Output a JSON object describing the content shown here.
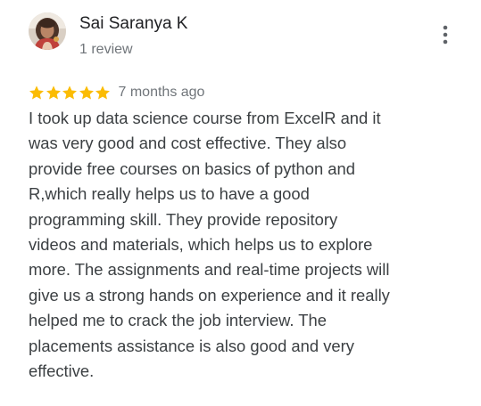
{
  "reviewer": {
    "name": "Sai Saranya K",
    "review_count": "1 review",
    "avatar_icon": "profile-photo"
  },
  "menu": {
    "icon": "more-vert-icon"
  },
  "rating": {
    "stars": 5,
    "max_stars": 5,
    "star_color": "#fbbc04",
    "date": "7 months ago"
  },
  "review": {
    "text": "I took up data science course from ExcelR and it\nwas very good and cost effective. They also\nprovide free courses on basics of python and\nR,which really helps us to have a good\nprogramming skill.  They provide repository\nvideos and materials, which helps us to explore\nmore. The assignments and real-time projects will\ngive us a strong hands on experience and it really\nhelped me to crack the job interview. The\nplacements assistance is also good and very\neffective."
  }
}
